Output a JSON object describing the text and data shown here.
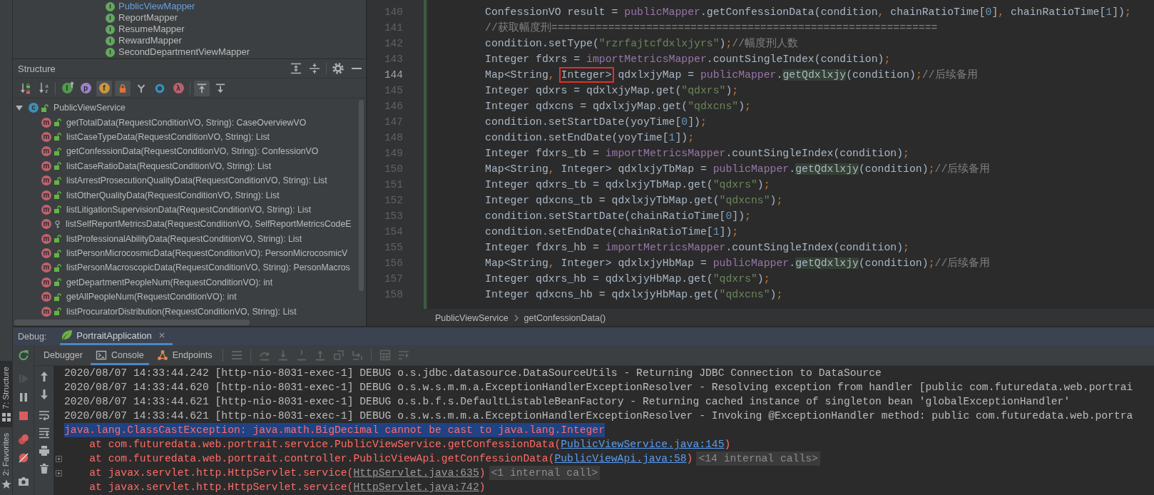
{
  "tool_strip": {
    "buttons": [
      {
        "kind": "structure",
        "label": "7: Structure",
        "selected": true
      },
      {
        "kind": "favorites",
        "label": "2: Favorites",
        "selected": false
      }
    ]
  },
  "project_tree": {
    "items": [
      {
        "badge": "I",
        "name": "PublicViewMapper",
        "modified": true
      },
      {
        "badge": "I",
        "name": "ReportMapper",
        "modified": false
      },
      {
        "badge": "I",
        "name": "ResumeMapper",
        "modified": false
      },
      {
        "badge": "I",
        "name": "RewardMapper",
        "modified": false
      },
      {
        "badge": "I",
        "name": "SecondDepartmentViewMapper",
        "modified": false
      }
    ]
  },
  "structure": {
    "title": "Structure",
    "toolbar": [
      {
        "kind": "sort-visibility",
        "pressed": false
      },
      {
        "kind": "sort-alpha",
        "letters": "az",
        "pressed": false
      },
      {
        "kind": "inherited",
        "letter": "I",
        "pressed": false
      },
      {
        "kind": "properties",
        "letter": "p",
        "pressed": false
      },
      {
        "kind": "fields",
        "letter": "f",
        "pressed": true
      },
      {
        "kind": "non-public",
        "pressed": true
      },
      {
        "kind": "anonymous",
        "pressed": false
      },
      {
        "kind": "ring",
        "pressed": false
      },
      {
        "kind": "lambdas",
        "letter": "λ",
        "pressed": false
      },
      {
        "kind": "scroll-to-source",
        "pressed": true
      },
      {
        "kind": "scroll-from-source",
        "pressed": false
      }
    ],
    "root": {
      "badge": "c",
      "public": true,
      "name": "PublicViewService",
      "expanded": true,
      "children": [
        {
          "badge": "m",
          "public": true,
          "signature": "getTotalData(RequestConditionVO, String): CaseOverviewVO"
        },
        {
          "badge": "m",
          "public": true,
          "signature": "listCaseTypeData(RequestConditionVO, String): List"
        },
        {
          "badge": "m",
          "public": true,
          "signature": "getConfessionData(RequestConditionVO, String): ConfessionVO"
        },
        {
          "badge": "m",
          "public": true,
          "signature": "listCaseRatioData(RequestConditionVO, String): List"
        },
        {
          "badge": "m",
          "public": true,
          "signature": "listArrestProsecutionQualityData(RequestConditionVO, String): List"
        },
        {
          "badge": "m",
          "public": true,
          "signature": "listOtherQualityData(RequestConditionVO, String): List"
        },
        {
          "badge": "m",
          "public": true,
          "signature": "listLitigationSupervisionData(RequestConditionVO, String): List"
        },
        {
          "badge": "m",
          "public": false,
          "signature": "listSelfReportMetricsData(RequestConditionVO, SelfReportMetricsCodeE"
        },
        {
          "badge": "m",
          "public": true,
          "signature": "listProfessionalAbilityData(RequestConditionVO, String): List"
        },
        {
          "badge": "m",
          "public": true,
          "signature": "listPersonMicrocosmicData(RequestConditionVO): PersonMicrocosmicV"
        },
        {
          "badge": "m",
          "public": true,
          "signature": "listPersonMacroscopicData(RequestConditionVO, String): PersonMacros"
        },
        {
          "badge": "m",
          "public": true,
          "signature": "getDepartmentPeopleNum(RequestConditionVO): int"
        },
        {
          "badge": "m",
          "public": true,
          "signature": "getAllPeopleNum(RequestConditionVO): int"
        },
        {
          "badge": "m",
          "public": true,
          "signature": "listProcuratorDistribution(RequestConditionVO, String): List"
        }
      ]
    }
  },
  "editor": {
    "lines": [
      {
        "number": "140",
        "current": false,
        "tokens": [
          {
            "kind": "plain",
            "text": "ConfessionVO result = "
          },
          {
            "kind": "field",
            "text": "publicMapper"
          },
          {
            "kind": "plain",
            "text": ".getConfessionData(condition"
          },
          {
            "kind": "punct",
            "text": ", "
          },
          {
            "kind": "plain",
            "text": "chainRatioTime["
          },
          {
            "kind": "number",
            "text": "0"
          },
          {
            "kind": "plain",
            "text": "]"
          },
          {
            "kind": "punct",
            "text": ", "
          },
          {
            "kind": "plain",
            "text": "chainRatioTime["
          },
          {
            "kind": "number",
            "text": "1"
          },
          {
            "kind": "plain",
            "text": "])"
          },
          {
            "kind": "punct",
            "text": ";"
          }
        ]
      },
      {
        "number": "141",
        "current": false,
        "tokens": [
          {
            "kind": "comment",
            "text": "//获取幅度刑============================================================="
          }
        ]
      },
      {
        "number": "142",
        "current": false,
        "tokens": [
          {
            "kind": "plain",
            "text": "condition.setType("
          },
          {
            "kind": "string",
            "text": "\"rzrfajtcfdxlxjyrs\""
          },
          {
            "kind": "plain",
            "text": ")"
          },
          {
            "kind": "punct",
            "text": ";"
          },
          {
            "kind": "comment",
            "text": "//幅度刑人数"
          }
        ]
      },
      {
        "number": "143",
        "current": false,
        "tokens": [
          {
            "kind": "plain",
            "text": "Integer fdxrs = "
          },
          {
            "kind": "field",
            "text": "importMetricsMapper"
          },
          {
            "kind": "plain",
            "text": ".countSingleIndex(condition)"
          },
          {
            "kind": "punct",
            "text": ";"
          }
        ]
      },
      {
        "number": "144",
        "current": true,
        "tokens": [
          {
            "kind": "plain",
            "text": "Map<String"
          },
          {
            "kind": "punct",
            "text": ", "
          },
          {
            "kind": "boxed",
            "text": "Integer>"
          },
          {
            "kind": "plain",
            "text": " qdxlxjyMap = "
          },
          {
            "kind": "field",
            "text": "publicMapper"
          },
          {
            "kind": "plain",
            "text": "."
          },
          {
            "kind": "usage",
            "text": "getQdxlxjy"
          },
          {
            "kind": "plain",
            "text": "(condition)"
          },
          {
            "kind": "punct",
            "text": ";"
          },
          {
            "kind": "comment",
            "text": "//后续备用"
          }
        ]
      },
      {
        "number": "145",
        "current": false,
        "tokens": [
          {
            "kind": "plain",
            "text": "Integer qdxrs = qdxlxjyMap.get("
          },
          {
            "kind": "string",
            "text": "\"qdxrs\""
          },
          {
            "kind": "plain",
            "text": ")"
          },
          {
            "kind": "punct",
            "text": ";"
          }
        ]
      },
      {
        "number": "146",
        "current": false,
        "tokens": [
          {
            "kind": "plain",
            "text": "Integer qdxcns = qdxlxjyMap.get("
          },
          {
            "kind": "string",
            "text": "\"qdxcns\""
          },
          {
            "kind": "plain",
            "text": ")"
          },
          {
            "kind": "punct",
            "text": ";"
          }
        ]
      },
      {
        "number": "147",
        "current": false,
        "tokens": [
          {
            "kind": "plain",
            "text": "condition.setStartDate(yoyTime["
          },
          {
            "kind": "number",
            "text": "0"
          },
          {
            "kind": "plain",
            "text": "])"
          },
          {
            "kind": "punct",
            "text": ";"
          }
        ]
      },
      {
        "number": "148",
        "current": false,
        "tokens": [
          {
            "kind": "plain",
            "text": "condition.setEndDate(yoyTime["
          },
          {
            "kind": "number",
            "text": "1"
          },
          {
            "kind": "plain",
            "text": "])"
          },
          {
            "kind": "punct",
            "text": ";"
          }
        ]
      },
      {
        "number": "149",
        "current": false,
        "tokens": [
          {
            "kind": "plain",
            "text": "Integer fdxrs_tb = "
          },
          {
            "kind": "field",
            "text": "importMetricsMapper"
          },
          {
            "kind": "plain",
            "text": ".countSingleIndex(condition)"
          },
          {
            "kind": "punct",
            "text": ";"
          }
        ]
      },
      {
        "number": "150",
        "current": false,
        "tokens": [
          {
            "kind": "plain",
            "text": "Map<String"
          },
          {
            "kind": "punct",
            "text": ", "
          },
          {
            "kind": "plain",
            "text": "Integer> qdxlxjyTbMap = "
          },
          {
            "kind": "field",
            "text": "publicMapper"
          },
          {
            "kind": "plain",
            "text": "."
          },
          {
            "kind": "usage",
            "text": "getQdxlxjy"
          },
          {
            "kind": "plain",
            "text": "(condition)"
          },
          {
            "kind": "punct",
            "text": ";"
          },
          {
            "kind": "comment",
            "text": "//后续备用"
          }
        ]
      },
      {
        "number": "151",
        "current": false,
        "tokens": [
          {
            "kind": "plain",
            "text": "Integer qdxrs_tb = qdxlxjyTbMap.get("
          },
          {
            "kind": "string",
            "text": "\"qdxrs\""
          },
          {
            "kind": "plain",
            "text": ")"
          },
          {
            "kind": "punct",
            "text": ";"
          }
        ]
      },
      {
        "number": "152",
        "current": false,
        "tokens": [
          {
            "kind": "plain",
            "text": "Integer qdxcns_tb = qdxlxjyTbMap.get("
          },
          {
            "kind": "string",
            "text": "\"qdxcns\""
          },
          {
            "kind": "plain",
            "text": ")"
          },
          {
            "kind": "punct",
            "text": ";"
          }
        ]
      },
      {
        "number": "153",
        "current": false,
        "tokens": [
          {
            "kind": "plain",
            "text": "condition.setStartDate(chainRatioTime["
          },
          {
            "kind": "number",
            "text": "0"
          },
          {
            "kind": "plain",
            "text": "])"
          },
          {
            "kind": "punct",
            "text": ";"
          }
        ]
      },
      {
        "number": "154",
        "current": false,
        "tokens": [
          {
            "kind": "plain",
            "text": "condition.setEndDate(chainRatioTime["
          },
          {
            "kind": "number",
            "text": "1"
          },
          {
            "kind": "plain",
            "text": "])"
          },
          {
            "kind": "punct",
            "text": ";"
          }
        ]
      },
      {
        "number": "155",
        "current": false,
        "tokens": [
          {
            "kind": "plain",
            "text": "Integer fdxrs_hb = "
          },
          {
            "kind": "field",
            "text": "importMetricsMapper"
          },
          {
            "kind": "plain",
            "text": ".countSingleIndex(condition)"
          },
          {
            "kind": "punct",
            "text": ";"
          }
        ]
      },
      {
        "number": "156",
        "current": false,
        "tokens": [
          {
            "kind": "plain",
            "text": "Map<String"
          },
          {
            "kind": "punct",
            "text": ", "
          },
          {
            "kind": "plain",
            "text": "Integer> qdxlxjyHbMap = "
          },
          {
            "kind": "field",
            "text": "publicMapper"
          },
          {
            "kind": "plain",
            "text": "."
          },
          {
            "kind": "usage",
            "text": "getQdxlxjy"
          },
          {
            "kind": "plain",
            "text": "(condition)"
          },
          {
            "kind": "punct",
            "text": ";"
          },
          {
            "kind": "comment",
            "text": "//后续备用"
          }
        ]
      },
      {
        "number": "157",
        "current": false,
        "tokens": [
          {
            "kind": "plain",
            "text": "Integer qdxrs_hb = qdxlxjyHbMap.get("
          },
          {
            "kind": "string",
            "text": "\"qdxrs\""
          },
          {
            "kind": "plain",
            "text": ")"
          },
          {
            "kind": "punct",
            "text": ";"
          }
        ]
      },
      {
        "number": "158",
        "current": false,
        "tokens": [
          {
            "kind": "plain",
            "text": "Integer qdxcns_hb = qdxlxjyHbMap.get("
          },
          {
            "kind": "string",
            "text": "\"qdxcns\""
          },
          {
            "kind": "plain",
            "text": ")"
          },
          {
            "kind": "punct",
            "text": ";"
          }
        ]
      }
    ]
  },
  "breadcrumb": [
    "PublicViewService",
    "getConfessionData()"
  ],
  "debug": {
    "title": "Debug:",
    "sessions": [
      {
        "label": "PortraitApplication",
        "selected": true
      }
    ],
    "side_toolbar": [
      {
        "kind": "rerun",
        "disabled": false
      },
      {
        "kind": "resume",
        "disabled": true
      },
      {
        "kind": "pause",
        "disabled": false
      },
      {
        "kind": "stop",
        "disabled": false
      },
      {
        "kind": "breakpoints",
        "disabled": false
      },
      {
        "kind": "mute",
        "disabled": false
      },
      {
        "kind": "dump",
        "disabled": false
      }
    ],
    "tabs": [
      {
        "kind": "debugger",
        "label": "Debugger",
        "selected": false
      },
      {
        "kind": "console",
        "label": "Console",
        "selected": true
      },
      {
        "kind": "endpoints",
        "label": "Endpoints",
        "selected": false
      }
    ],
    "step_toolbar": [
      {
        "kind": "show-point",
        "disabled": true
      },
      {
        "kind": "step-over",
        "disabled": true
      },
      {
        "kind": "step-into",
        "disabled": true
      },
      {
        "kind": "force-step-into",
        "disabled": true
      },
      {
        "kind": "step-out",
        "disabled": true
      },
      {
        "kind": "drop-frame",
        "disabled": true
      },
      {
        "kind": "run-to-cursor",
        "disabled": true
      },
      {
        "kind": "evaluate",
        "disabled": true
      },
      {
        "kind": "trace",
        "disabled": true
      }
    ],
    "console_toolbar": [
      {
        "kind": "up"
      },
      {
        "kind": "down"
      },
      {
        "kind": "wrap"
      },
      {
        "kind": "scroll-end"
      },
      {
        "kind": "print"
      },
      {
        "kind": "clear"
      }
    ],
    "console": [
      {
        "kind": "log",
        "selected": false,
        "text": "2020/08/07 14:33:44.242 [http-nio-8031-exec-1] DEBUG o.s.jdbc.datasource.DataSourceUtils - Returning JDBC Connection to DataSource"
      },
      {
        "kind": "log",
        "selected": false,
        "text": "2020/08/07 14:33:44.620 [http-nio-8031-exec-1] DEBUG o.s.w.s.m.m.a.ExceptionHandlerExceptionResolver - Resolving exception from handler [public com.futuredata.web.portrai"
      },
      {
        "kind": "log",
        "selected": false,
        "text": "2020/08/07 14:33:44.621 [http-nio-8031-exec-1] DEBUG o.s.b.f.s.DefaultListableBeanFactory - Returning cached instance of singleton bean 'globalExceptionHandler'"
      },
      {
        "kind": "log",
        "selected": false,
        "text": "2020/08/07 14:33:44.621 [http-nio-8031-exec-1] DEBUG o.s.w.s.m.m.a.ExceptionHandlerExceptionResolver - Invoking @ExceptionHandler method: public com.futuredata.web.portra"
      },
      {
        "kind": "error",
        "selected": true,
        "text": "java.lang.ClassCastException: java.math.BigDecimal cannot be cast to java.lang.Integer"
      },
      {
        "kind": "frame",
        "selected": false,
        "text": "at com.futuredata.web.portrait.service.PublicViewService.getConfessionData(",
        "link": {
          "kind": "source",
          "text": "PublicViewService.java:145"
        },
        "tail": ")"
      },
      {
        "kind": "frame",
        "selected": false,
        "text": "at com.futuredata.web.portrait.controller.PublicViewApi.getConfessionData(",
        "link": {
          "kind": "source",
          "text": "PublicViewApi.java:58"
        },
        "tail": ")",
        "folded": "<14 internal calls>"
      },
      {
        "kind": "frame",
        "selected": false,
        "text": "at javax.servlet.http.HttpServlet.service(",
        "link": {
          "kind": "library",
          "text": "HttpServlet.java:635"
        },
        "tail": ")",
        "folded": "<1 internal call>"
      },
      {
        "kind": "frame",
        "selected": false,
        "text": "at javax.servlet.http.HttpServlet.service(",
        "link": {
          "kind": "library",
          "text": "HttpServlet.java:742"
        },
        "tail": ")"
      }
    ]
  }
}
